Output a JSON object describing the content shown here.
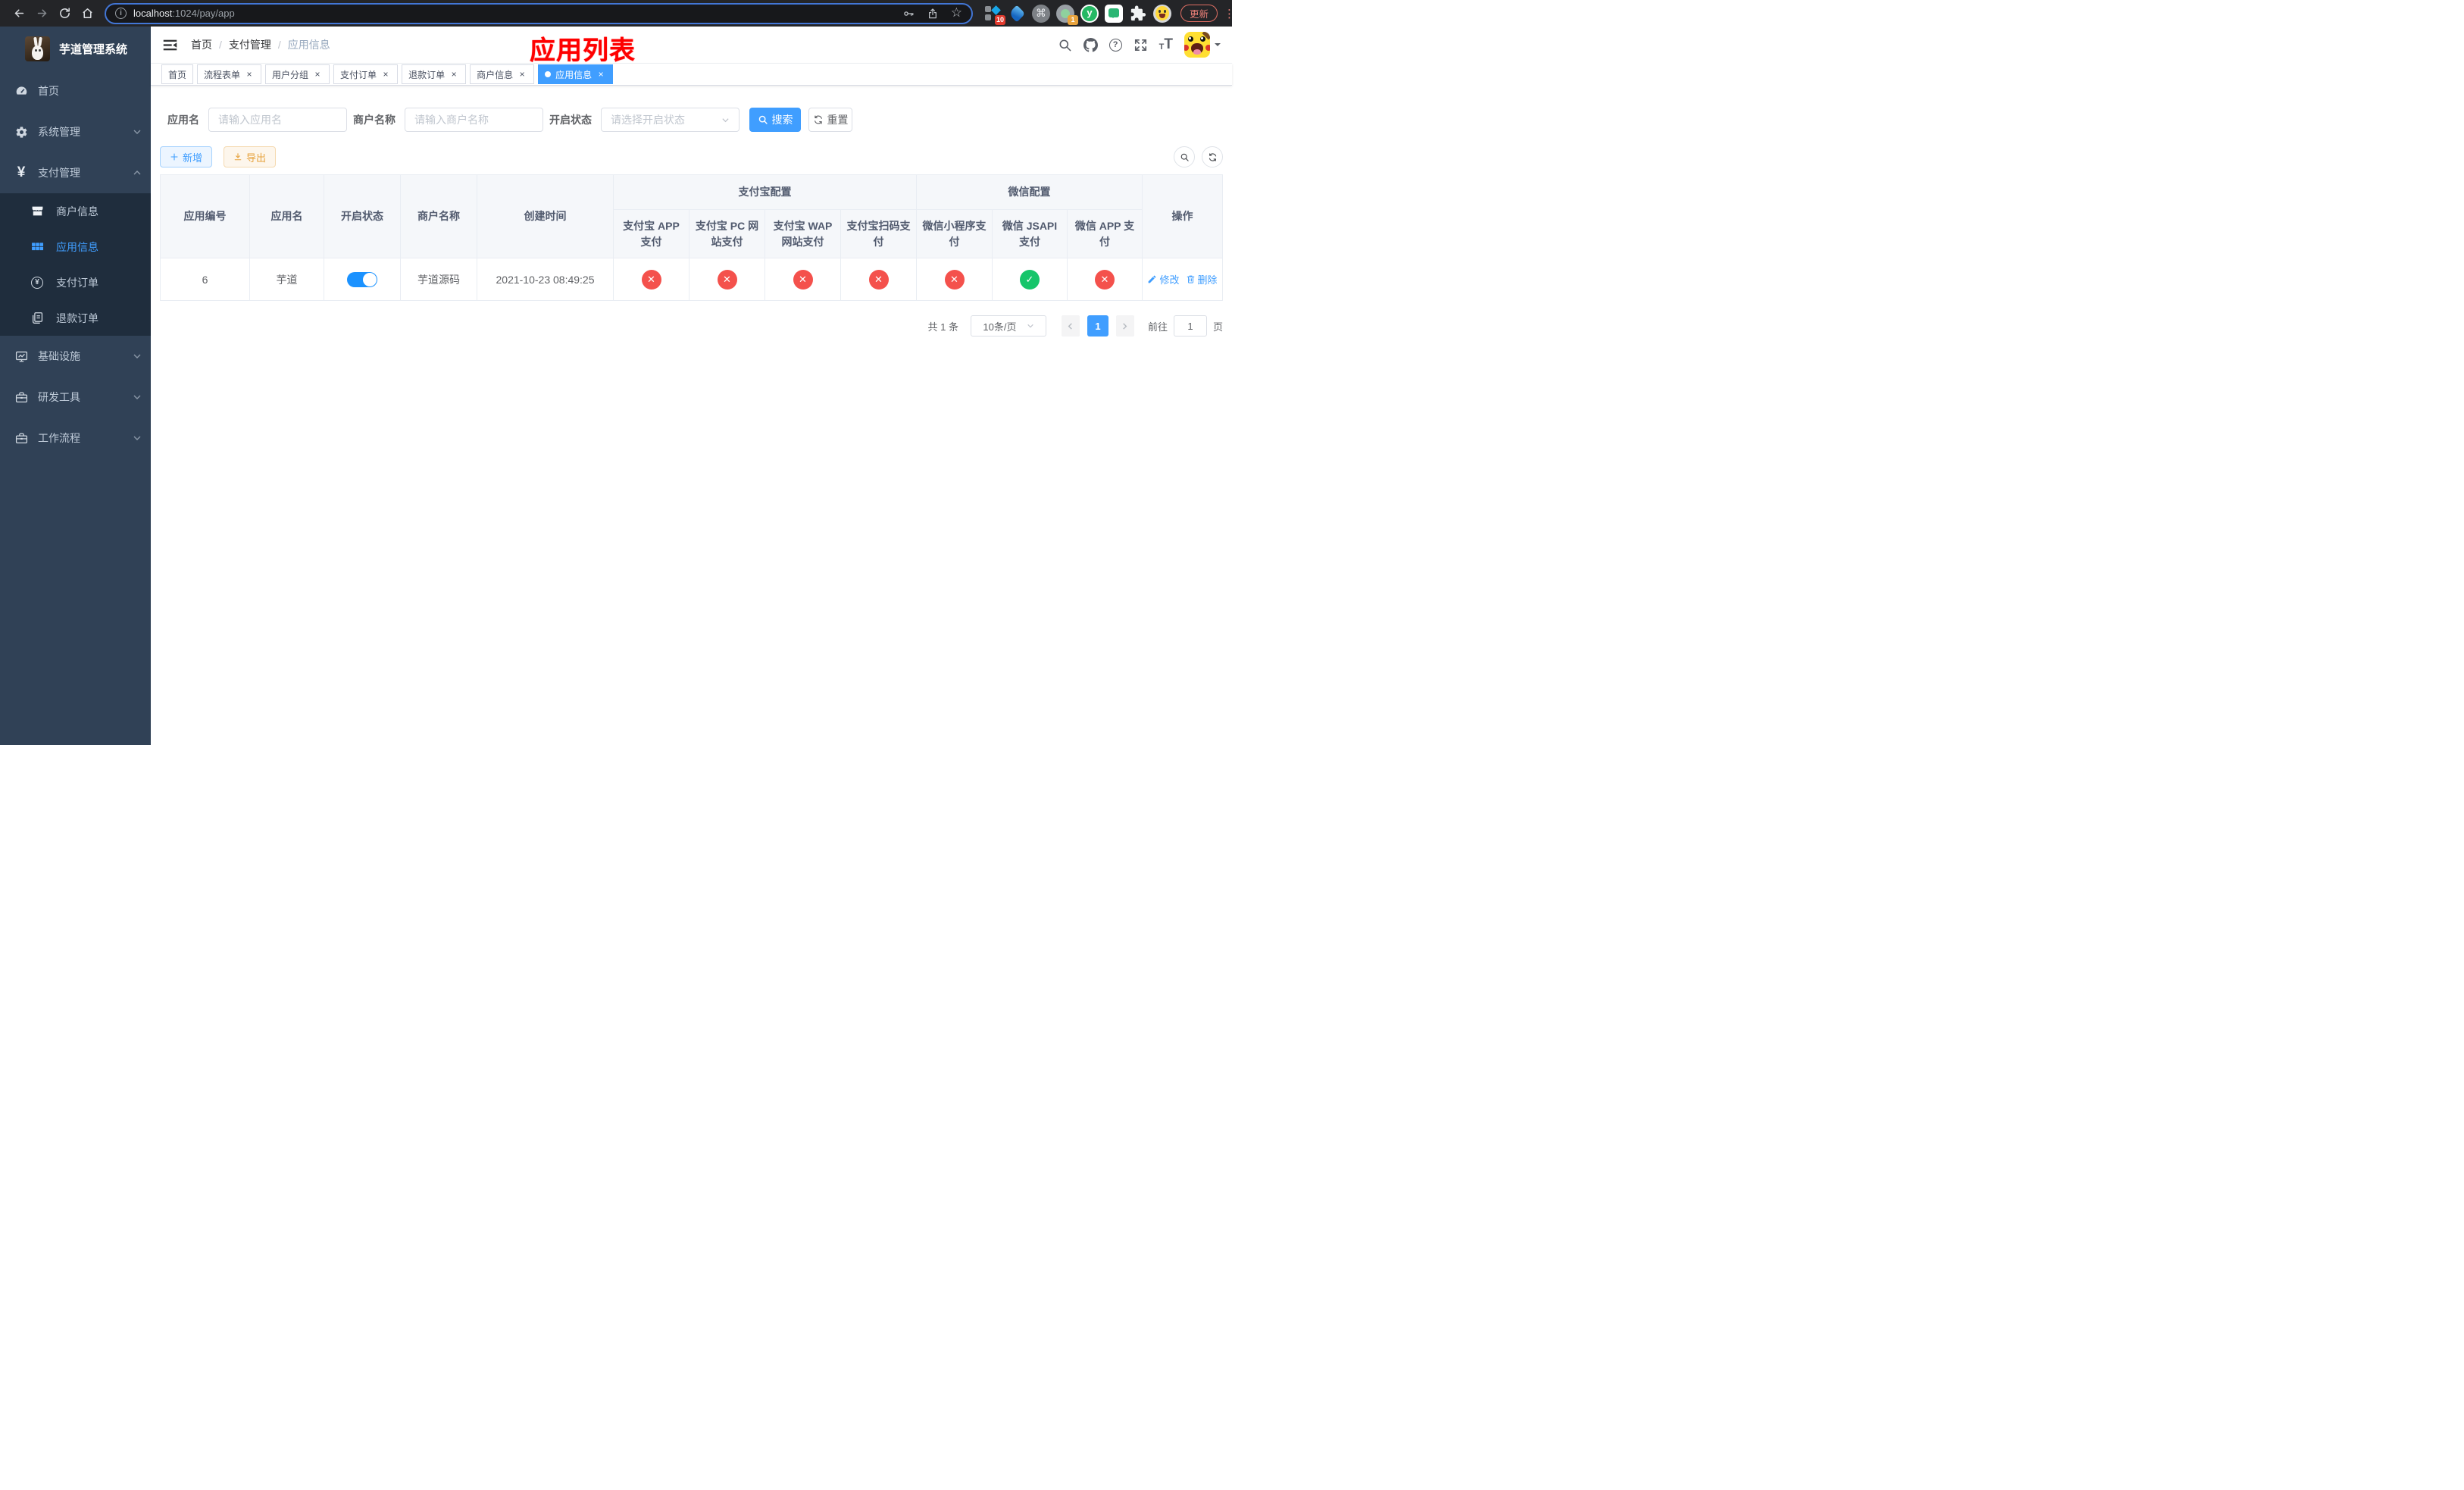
{
  "browser": {
    "url": {
      "host": "localhost",
      "rest": ":1024/pay/app"
    },
    "extensions": {
      "badge_apps": "10",
      "badge_profile": "1"
    },
    "update_label": "更新"
  },
  "sidebar": {
    "title": "芋道管理系统",
    "items": {
      "home": "首页",
      "system": "系统管理",
      "payment": "支付管理",
      "merchant_info": "商户信息",
      "app_info": "应用信息",
      "pay_order": "支付订单",
      "refund_order": "退款订单",
      "infrastructure": "基础设施",
      "dev_tools": "研发工具",
      "workflow": "工作流程"
    }
  },
  "header": {
    "breadcrumb": {
      "home": "首页",
      "section": "支付管理",
      "current": "应用信息"
    },
    "annotation_title": "应用列表"
  },
  "tabs": [
    {
      "label": "首页"
    },
    {
      "label": "流程表单"
    },
    {
      "label": "用户分组"
    },
    {
      "label": "支付订单"
    },
    {
      "label": "退款订单"
    },
    {
      "label": "商户信息"
    },
    {
      "label": "应用信息"
    }
  ],
  "filters": {
    "app_name_label": "应用名",
    "app_name_placeholder": "请输入应用名",
    "merchant_label": "商户名称",
    "merchant_placeholder": "请输入商户名称",
    "status_label": "开启状态",
    "status_placeholder": "请选择开启状态",
    "search_label": "搜索",
    "reset_label": "重置"
  },
  "toolbar": {
    "add_label": "新增",
    "export_label": "导出"
  },
  "table": {
    "groups": {
      "alipay": "支付宝配置",
      "wechat": "微信配置"
    },
    "columns": {
      "id": "应用编号",
      "name": "应用名",
      "status": "开启状态",
      "merchant": "商户名称",
      "created": "创建时间",
      "alipay_app": "支付宝 APP 支付",
      "alipay_pc": "支付宝 PC 网站支付",
      "alipay_wap": "支付宝 WAP 网站支付",
      "alipay_qr": "支付宝扫码支付",
      "wx_mini": "微信小程序支付",
      "wx_jsapi": "微信 JSAPI 支付",
      "wx_app": "微信 APP 支付",
      "actions": "操作"
    },
    "row": {
      "id": "6",
      "name": "芋道",
      "enabled": "on",
      "merchant": "芋道源码",
      "created": "2021-10-23 08:49:25",
      "alipay_app": "fail",
      "alipay_pc": "fail",
      "alipay_wap": "fail",
      "alipay_qr": "fail",
      "wx_mini": "fail",
      "wx_jsapi": "success",
      "wx_app": "fail",
      "edit_label": "修改",
      "delete_label": "删除"
    }
  },
  "pagination": {
    "total": "共 1 条",
    "page_size": "10条/页",
    "current_page": "1",
    "goto_prefix": "前往",
    "goto_value": "1",
    "goto_suffix": "页"
  },
  "colors": {
    "accent": "#409eff",
    "danger": "#f4514c",
    "success": "#16c56a",
    "warning": "#e6a23c",
    "sidebar_bg": "#304156",
    "submenu_bg": "#1f2d3d",
    "annotation_red": "#fe0000"
  }
}
